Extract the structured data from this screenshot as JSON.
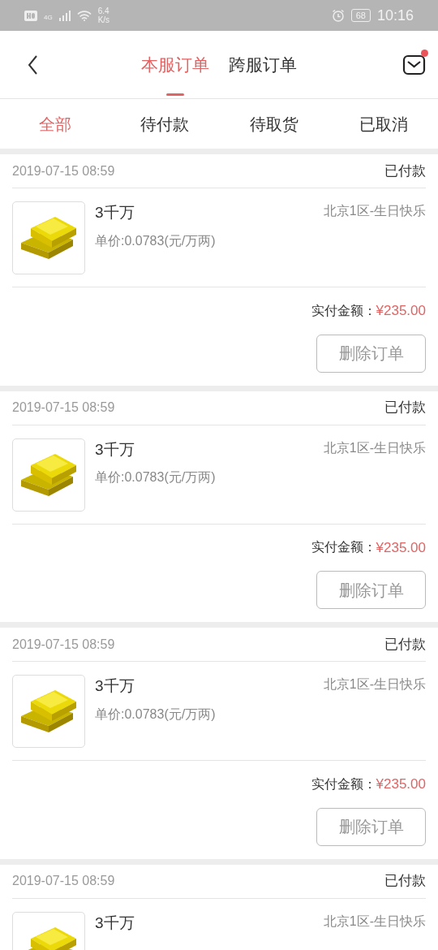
{
  "status_bar": {
    "network": "4G",
    "speed_value": "6.4",
    "speed_unit": "K/s",
    "battery": "68",
    "time": "10:16"
  },
  "header": {
    "tabs": [
      {
        "label": "本服订单",
        "selected": true
      },
      {
        "label": "跨服订单",
        "selected": false
      }
    ],
    "has_unread_messages": true
  },
  "filter_tabs": [
    {
      "label": "全部",
      "selected": true
    },
    {
      "label": "待付款",
      "selected": false
    },
    {
      "label": "待取货",
      "selected": false
    },
    {
      "label": "已取消",
      "selected": false
    }
  ],
  "orders": [
    {
      "date": "2019-07-15 08:59",
      "status": "已付款",
      "item_name": "3千万",
      "server": "北京1区-生日快乐",
      "unit_price": "单价:0.0783(元/万两)",
      "amount_label": "实付金额：",
      "amount": "¥235.00",
      "action": "删除订单"
    },
    {
      "date": "2019-07-15 08:59",
      "status": "已付款",
      "item_name": "3千万",
      "server": "北京1区-生日快乐",
      "unit_price": "单价:0.0783(元/万两)",
      "amount_label": "实付金额：",
      "amount": "¥235.00",
      "action": "删除订单"
    },
    {
      "date": "2019-07-15 08:59",
      "status": "已付款",
      "item_name": "3千万",
      "server": "北京1区-生日快乐",
      "unit_price": "单价:0.0783(元/万两)",
      "amount_label": "实付金额：",
      "amount": "¥235.00",
      "action": "删除订单"
    },
    {
      "date": "2019-07-15 08:59",
      "status": "已付款",
      "item_name": "3千万",
      "server": "北京1区-生日快乐"
    }
  ]
}
